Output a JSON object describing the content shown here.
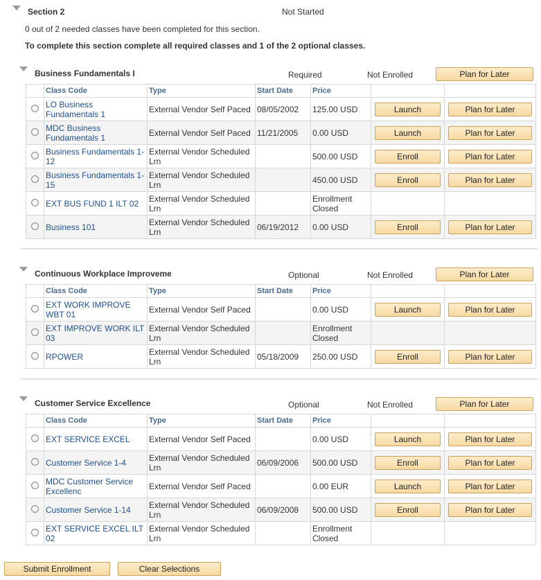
{
  "section": {
    "title": "Section 2",
    "status": "Not Started",
    "progress_text": "0 out of 2 needed classes have been completed for this section.",
    "instruction": "To complete this section complete all required classes and 1 of  the 2 optional classes."
  },
  "columns": [
    "Class Code",
    "Type",
    "Start Date",
    "Price"
  ],
  "groups": [
    {
      "title": "Business Fundamentals I",
      "requirement": "Required",
      "enroll_status": "Not Enrolled",
      "plan_label": "Plan for Later",
      "rows": [
        {
          "code": "LO Business Fundamentals 1",
          "type": "External Vendor Self Paced",
          "start": "08/05/2002",
          "price": "125.00 USD",
          "action": "Launch",
          "plan": "Plan for Later"
        },
        {
          "code": "MDC Business Fundamentals 1",
          "type": "External Vendor Self Paced",
          "start": "11/21/2005",
          "price": "0.00 USD",
          "action": "Launch",
          "plan": "Plan for Later"
        },
        {
          "code": "Business Fundamentals 1-12",
          "type": "External Vendor Scheduled Lrn",
          "start": "",
          "price": "500.00 USD",
          "action": "Enroll",
          "plan": "Plan for Later"
        },
        {
          "code": "Business Fundamentals 1-15",
          "type": "External Vendor Scheduled Lrn",
          "start": "",
          "price": "450.00 USD",
          "action": "Enroll",
          "plan": "Plan for Later"
        },
        {
          "code": "EXT BUS FUND 1 ILT 02",
          "type": "External Vendor Scheduled Lrn",
          "start": "",
          "price": "Enrollment Closed",
          "action": "",
          "plan": ""
        },
        {
          "code": "Business 101",
          "type": "External Vendor Scheduled Lrn",
          "start": "06/19/2012",
          "price": "0.00 USD",
          "action": "Enroll",
          "plan": "Plan for Later"
        }
      ]
    },
    {
      "title": "Continuous Workplace Improveme",
      "requirement": "Optional",
      "enroll_status": "Not Enrolled",
      "plan_label": "Plan for Later",
      "rows": [
        {
          "code": "EXT WORK IMPROVE WBT 01",
          "type": "External Vendor Self Paced",
          "start": "",
          "price": "0.00 USD",
          "action": "Launch",
          "plan": "Plan for Later"
        },
        {
          "code": "EXT IMPROVE WORK ILT 03",
          "type": "External Vendor Scheduled Lrn",
          "start": "",
          "price": "Enrollment Closed",
          "action": "",
          "plan": ""
        },
        {
          "code": "RPOWER",
          "type": "External Vendor Scheduled Lrn",
          "start": "05/18/2009",
          "price": "250.00 USD",
          "action": "Enroll",
          "plan": "Plan for Later"
        }
      ]
    },
    {
      "title": "Customer Service Excellence",
      "requirement": "Optional",
      "enroll_status": "Not Enrolled",
      "plan_label": "Plan for Later",
      "rows": [
        {
          "code": "EXT SERVICE EXCEL",
          "type": "External Vendor Self Paced",
          "start": "",
          "price": "0.00 USD",
          "action": "Launch",
          "plan": "Plan for Later"
        },
        {
          "code": "Customer Service 1-4",
          "type": "External Vendor Scheduled Lrn",
          "start": "06/09/2006",
          "price": "500.00 USD",
          "action": "Enroll",
          "plan": "Plan for Later"
        },
        {
          "code": "MDC Customer Service Excellenc",
          "type": "External Vendor Self Paced",
          "start": "",
          "price": "0.00 EUR",
          "action": "Launch",
          "plan": "Plan for Later"
        },
        {
          "code": "Customer Service 1-14",
          "type": "External Vendor Scheduled Lrn",
          "start": "06/09/2008",
          "price": "500.00 USD",
          "action": "Enroll",
          "plan": "Plan for Later"
        },
        {
          "code": "EXT SERVICE EXCEL ILT 02",
          "type": "External Vendor Scheduled Lrn",
          "start": "",
          "price": "Enrollment Closed",
          "action": "",
          "plan": ""
        }
      ]
    }
  ],
  "footer": {
    "submit_label": "Submit Enrollment",
    "clear_label": "Clear Selections"
  }
}
